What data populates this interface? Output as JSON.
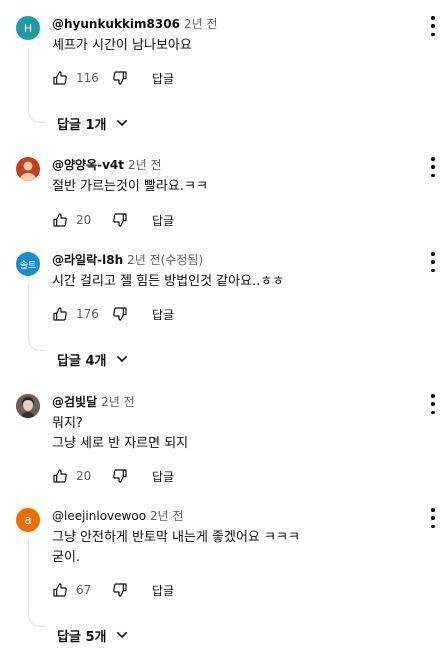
{
  "comments": [
    {
      "author": "@hyunkukkim8306",
      "time": "2년 전",
      "lines": [
        "셰프가 시간이 남나보아요"
      ],
      "likes": "116",
      "reply_label": "답글",
      "replies_label": "답글 1개",
      "avatar_letter": "H",
      "avatar_color": "#1e9aa7"
    },
    {
      "author": "@양양옥-v4t",
      "time": "2년 전",
      "lines": [
        "절반  가르는것이 빨라요.ㅋㅋ"
      ],
      "likes": "20",
      "reply_label": "답글",
      "avatar_letter": "",
      "avatar_color": "#c2411c"
    },
    {
      "author": "@라일락-l8h",
      "time": "2년 전(수정됨)",
      "lines": [
        "시간 걸리고 젤 힘든 방법인것 같아요..ㅎㅎ"
      ],
      "likes": "176",
      "reply_label": "답글",
      "replies_label": "답글 4개",
      "avatar_letter": "솔트",
      "avatar_color": "#1a8cc7"
    },
    {
      "author": "@검빛달",
      "time": "2년 전",
      "lines": [
        "뭐지?",
        "그냥 세로 반 자르면 되지"
      ],
      "likes": "20",
      "reply_label": "답글",
      "avatar_letter": "",
      "avatar_color": "#8a7670"
    },
    {
      "author": "@leejinlovewoo",
      "time": "2년 전",
      "lines": [
        "그냥 안전하게 반토막 내는게 좋겠어요 ㅋㅋㅋ",
        "굳이."
      ],
      "likes": "67",
      "reply_label": "답글",
      "replies_label": "답글 5개",
      "avatar_letter": "a",
      "avatar_color": "#ef6c00"
    }
  ]
}
